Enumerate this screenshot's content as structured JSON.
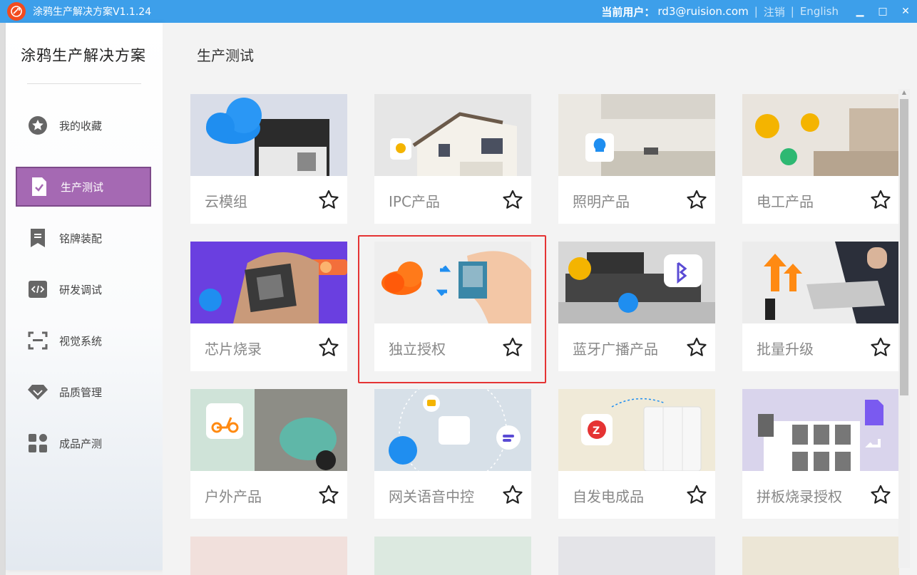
{
  "app": {
    "title": "涂鸦生产解决方案V1.1.24",
    "current_user_label": "当前用户：",
    "current_user": "rd3@ruision.com",
    "logout": "注销",
    "language": "English"
  },
  "sidebar": {
    "title": "涂鸦生产解决方案",
    "items": [
      {
        "label": "我的收藏",
        "icon": "star-circle-icon"
      },
      {
        "label": "生产测试",
        "icon": "document-check-icon",
        "active": true
      },
      {
        "label": "铭牌装配",
        "icon": "bookmark-icon"
      },
      {
        "label": "研发调试",
        "icon": "code-window-icon"
      },
      {
        "label": "视觉系统",
        "icon": "scan-frame-icon"
      },
      {
        "label": "品质管理",
        "icon": "diamond-icon"
      },
      {
        "label": "成品产测",
        "icon": "grid-apps-icon"
      }
    ]
  },
  "main": {
    "page_title": "生产测试",
    "cards": [
      {
        "label": "云模组"
      },
      {
        "label": "IPC产品"
      },
      {
        "label": "照明产品"
      },
      {
        "label": "电工产品"
      },
      {
        "label": "芯片烧录"
      },
      {
        "label": "独立授权",
        "highlighted": true
      },
      {
        "label": "蓝牙广播产品"
      },
      {
        "label": "批量升级"
      },
      {
        "label": "户外产品"
      },
      {
        "label": "网关语音中控"
      },
      {
        "label": "自发电成品"
      },
      {
        "label": "拼板烧录授权"
      }
    ]
  },
  "colors": {
    "titlebar": "#3d9fea",
    "active_nav": "#a569b3",
    "highlight_border": "#e53333"
  }
}
